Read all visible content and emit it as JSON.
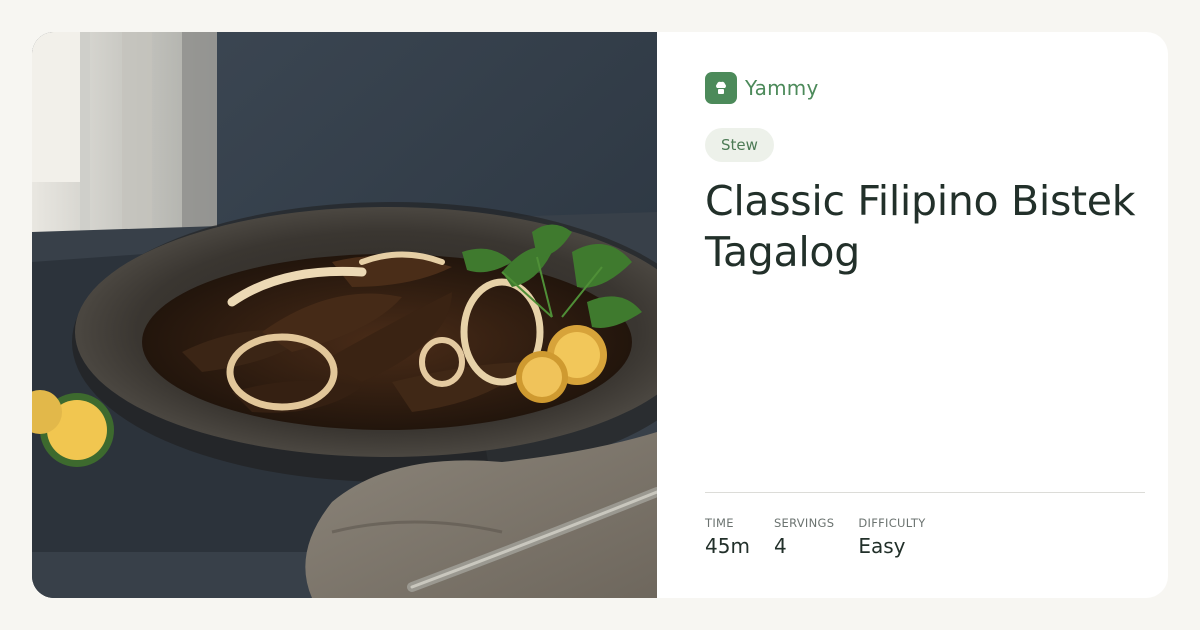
{
  "brand": {
    "name": "Yammy",
    "logo_icon": "chef-hat-icon",
    "accent": "#4c8a5a"
  },
  "recipe": {
    "category": "Stew",
    "title": "Classic Filipino Bistek Tagalog",
    "photo_icon": "dish-photo"
  },
  "stats": [
    {
      "label": "TIME",
      "value": "45m"
    },
    {
      "label": "SERVINGS",
      "value": "4"
    },
    {
      "label": "DIFFICULTY",
      "value": "Easy"
    }
  ]
}
